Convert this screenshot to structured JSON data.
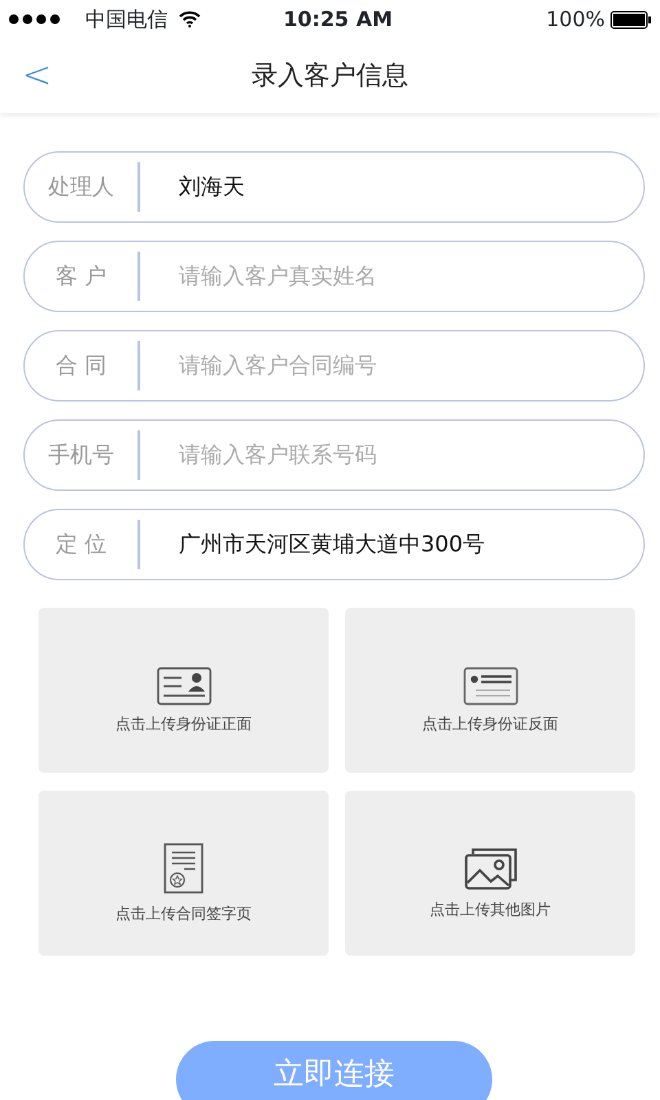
{
  "status_bar": {
    "carrier": "中国电信",
    "time": "10:25 AM",
    "battery": "100%"
  },
  "header": {
    "back": "<",
    "title": "录入客户信息"
  },
  "fields": [
    {
      "label": "处理人",
      "value": "刘海天"
    },
    {
      "label": "客 户",
      "placeholder": "请输入客户真实姓名"
    },
    {
      "label": "合 同",
      "placeholder": "请输入客户合同编号"
    },
    {
      "label": "手机号",
      "placeholder": "请输入客户联系号码"
    },
    {
      "label": "定 位",
      "value": "广州市天河区黄埔大道中300号"
    }
  ],
  "uploads": [
    {
      "label": "点击上传身份证正面"
    },
    {
      "label": "点击上传身份证反面"
    },
    {
      "label": "点击上传合同签字页"
    },
    {
      "label": "点击上传其他图片"
    }
  ],
  "submit": "立即连接"
}
